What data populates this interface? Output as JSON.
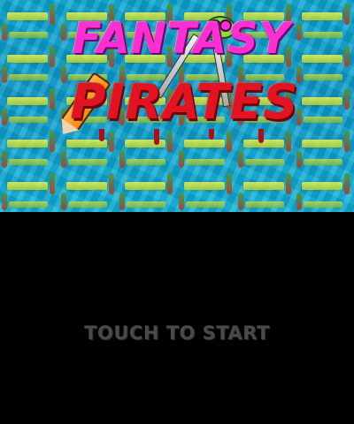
{
  "game": {
    "logo": {
      "line1": "FANTASY",
      "line2": "PIRATES"
    },
    "prompt": "TOUCH TO START",
    "colors": {
      "water": "#0aa7cf",
      "logo_line1": "#ff2ed3",
      "logo_line2": "#e41321",
      "bottom_bg": "#000000",
      "prompt_text": "#4a4a4a"
    },
    "icons": [
      "frog-mascot-icon",
      "crossed-swords-icon",
      "pencil-icon"
    ]
  }
}
